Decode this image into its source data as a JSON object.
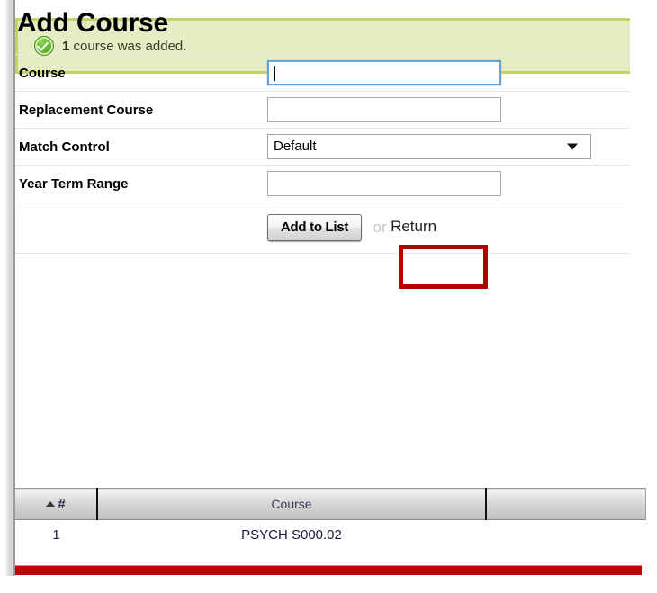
{
  "page": {
    "title": "Add Course"
  },
  "form": {
    "rows": [
      {
        "label": "Course",
        "type": "text",
        "value": "",
        "placeholder": "",
        "focused": true
      },
      {
        "label": "Replacement Course",
        "type": "text",
        "value": "",
        "placeholder": "",
        "focused": false
      },
      {
        "label": "Match Control",
        "type": "select",
        "value": "Default",
        "options": [
          "Default"
        ],
        "focused": false
      },
      {
        "label": "Year Term Range",
        "type": "text",
        "value": "",
        "placeholder": "",
        "focused": false
      }
    ]
  },
  "actions": {
    "submit_label": "Add to List",
    "or_label": "or",
    "return_label": "Return",
    "annotation_color": "#b20000"
  },
  "alert": {
    "icon": "check-circle-icon",
    "count": "1",
    "message": " course was added.",
    "background": "#e4edc4",
    "border": "#c2d469"
  },
  "grid": {
    "columns": [
      {
        "key": "num",
        "label": "#",
        "sorted": true,
        "sort_direction": "asc"
      },
      {
        "key": "course",
        "label": "Course",
        "sorted": false,
        "sort_direction": ""
      },
      {
        "key": "extra",
        "label": "",
        "sorted": false,
        "sort_direction": ""
      }
    ],
    "rows": [
      {
        "num": "1",
        "course": "PSYCH S000.02",
        "extra": ""
      }
    ],
    "footer_color": "#c40000"
  }
}
